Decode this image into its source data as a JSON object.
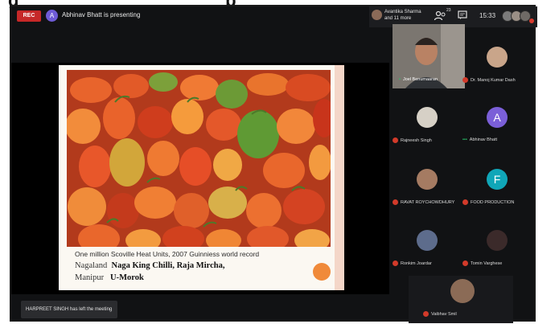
{
  "top_bar": {
    "rec_label": "REC",
    "presenter_initial": "A",
    "presenting_text": "Abhinav Bhatt is presenting"
  },
  "top_right": {
    "host_line1": "Avantika Sharma",
    "host_line2": "and 11 more",
    "participants_count": "23",
    "clock": "15:33"
  },
  "slide": {
    "caption_top": "One million Scoville Heat Units, 2007 Guinniess world record",
    "line1_prefix": "Nagaland",
    "line1_bold": "Naga King Chilli, Raja Mircha,",
    "line2_prefix": "Manipur",
    "line2_bold": "U-Morok"
  },
  "notification": {
    "text": "HARPREET SINGH has left the meeting"
  },
  "participants": [
    {
      "name": "Dr. Manoj Kumar Dash",
      "initial": ""
    },
    {
      "name": "Rajneesh Singh",
      "initial": ""
    },
    {
      "name": "Abhinav Bhatt",
      "initial": "A"
    },
    {
      "name": "RAVAT ROYCHOWDHURY",
      "initial": ""
    },
    {
      "name": "FOOD PRODUCTION",
      "initial": "F"
    },
    {
      "name": "Ronkim Joardar",
      "initial": ""
    },
    {
      "name": "Tomin Varghese",
      "initial": ""
    },
    {
      "name": "Vaibhav Smil",
      "initial": ""
    }
  ],
  "video_tile": {
    "name": "Joel Benumaaran"
  },
  "colors": {
    "background": "#111214",
    "rec": "#c62828",
    "accent_purple": "#6e5bd6",
    "accent_teal": "#10a6b8",
    "mic_off": "#d23a2a"
  }
}
